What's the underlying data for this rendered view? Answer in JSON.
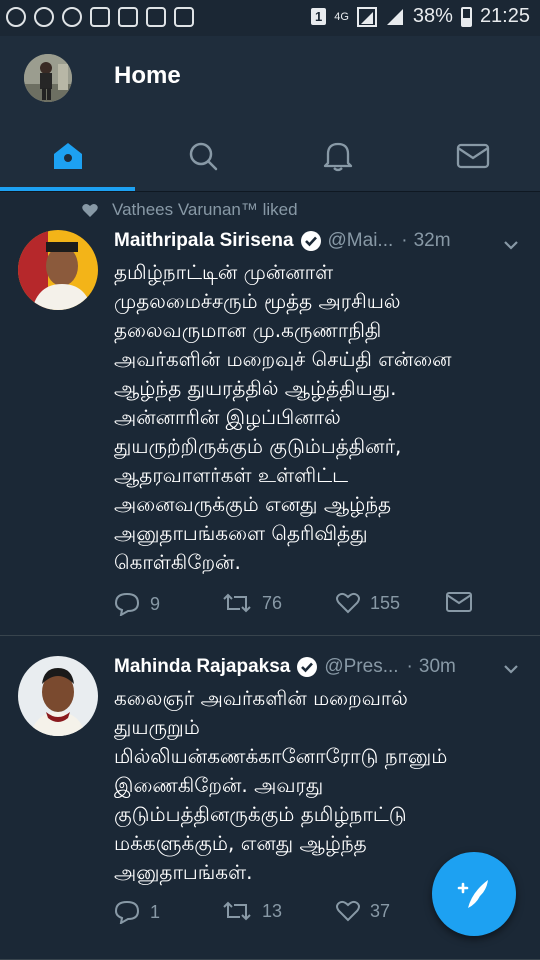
{
  "status_bar": {
    "sim_slot": "1",
    "network": "4G",
    "battery": "38%",
    "time": "21:25",
    "icons": [
      "whatsapp-icon",
      "settings-icon",
      "messenger-icon",
      "phone-icon",
      "gallery-icon",
      "instagram-icon",
      "app-icon"
    ]
  },
  "header": {
    "title": "Home"
  },
  "tabs": [
    {
      "name": "home",
      "icon": "home-icon",
      "active": true
    },
    {
      "name": "search",
      "icon": "search-icon",
      "active": false
    },
    {
      "name": "notifications",
      "icon": "bell-icon",
      "active": false
    },
    {
      "name": "messages",
      "icon": "mail-icon",
      "active": false
    }
  ],
  "tweets": [
    {
      "social_context": "Vathees Varunan™ liked",
      "name": "Maithripala Sirisena",
      "handle": "@Mai...",
      "time": "32m",
      "text": "தமிழ்நாட்டின் முன்னாள்\nமுதலமைச்சரும் மூத்த அரசியல்\nதலைவருமான மு.கருணாநிதி\nஅவர்களின் மறைவுச் செய்தி என்னை\nஆழ்ந்த துயரத்தில் ஆழ்த்தியது.\nஅன்னாரின் இழப்பினால்\nதுயருற்றிருக்கும் குடும்பத்தினர்,\nஆதரவாளர்கள் உள்ளிட்ட\nஅனைவருக்கும் எனது ஆழ்ந்த\nஅனுதாபங்களை தெரிவித்து\nகொள்கிறேன்.",
      "replies": "9",
      "retweets": "76",
      "likes": "155"
    },
    {
      "name": "Mahinda Rajapaksa",
      "handle": "@Pres...",
      "time": "30m",
      "text": "கலைஞர் அவர்களின் மறைவால்\nதுயருறும்\nமில்லியன்கணக்கானோரோடு நானும்\nஇணைகிறேன். அவரது\nகுடும்பத்தினருக்கும் தமிழ்நாட்டு\nமக்களுக்கும், எனது ஆழ்ந்த\nஅனுதாபங்கள்.",
      "replies": "1",
      "retweets": "13",
      "likes": "37"
    }
  ],
  "colors": {
    "background": "#1b2836",
    "accent": "#1da1f2",
    "muted": "#8899a6",
    "divider": "#38444d"
  }
}
